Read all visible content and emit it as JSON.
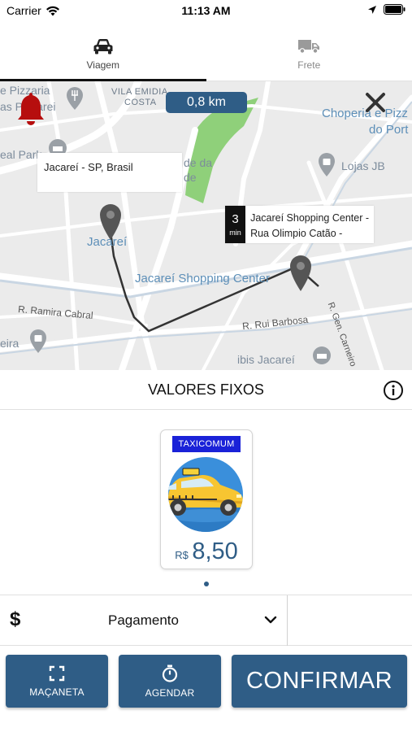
{
  "status_bar": {
    "carrier": "Carrier",
    "time": "11:13 AM"
  },
  "tabs": [
    {
      "label": "Viagem",
      "icon": "car-icon",
      "active": true
    },
    {
      "label": "Frete",
      "icon": "truck-icon",
      "active": false
    }
  ],
  "map": {
    "distance": "0,8 km",
    "origin_label": "Jacareí - SP, Brasil",
    "eta_value": "3",
    "eta_unit": "min",
    "destination_line1": "Jacareí Shopping Center -",
    "destination_line2": "Rua Olimpio Catão -",
    "places": {
      "pizzaria1": "e Pizzaria",
      "pizzaria2": "as Pizzarei",
      "vila1": "VILA EMIDIA",
      "vila2": "COSTA",
      "choperia1": "Choperia e Pizz",
      "choperia2": "do Port",
      "park": "eal Park",
      "da": "de da",
      "de": "de",
      "lojas": "Lojas JB",
      "jacarei": "Jacareí",
      "shopping": "Jacareí Shopping Center",
      "ramira": "R. Ramira Cabral",
      "barbosa": "R. Rui Barbosa",
      "carneiro": "R. Gen. Carneiro",
      "eira": "eira",
      "ibis": "ibis Jacareí"
    },
    "accent_color": "#2f5d86"
  },
  "values_header": {
    "title": "VALORES FIXOS"
  },
  "vehicle": {
    "badge": "TAXICOMUM",
    "currency": "R$",
    "price": "8,50",
    "badge_color": "#1a22d8"
  },
  "payment": {
    "symbol": "$",
    "label": "Pagamento"
  },
  "buttons": {
    "handle": "MAÇANETA",
    "schedule": "AGENDAR",
    "confirm": "CONFIRMAR"
  }
}
